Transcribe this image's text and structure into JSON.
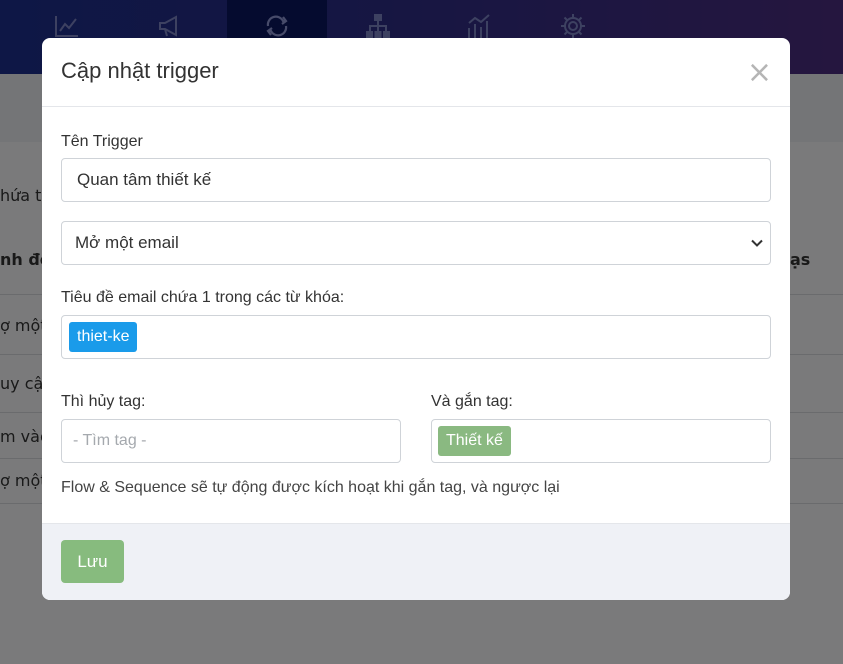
{
  "background": {
    "fragments": [
      "hứa t",
      "nh độ",
      "ợ một",
      "uy cập",
      "m vào",
      "ợ một",
      "ạs"
    ]
  },
  "nav": {
    "icons": [
      "chart-icon",
      "megaphone-icon",
      "repeat-icon",
      "sitemap-icon",
      "bar-chart-icon",
      "gear-icon"
    ]
  },
  "modal": {
    "title": "Cập nhật trigger",
    "close_label": "×",
    "name_label": "Tên Trigger",
    "name_value": "Quan tâm thiết kế",
    "event_select": {
      "selected": "Mở một email"
    },
    "keywords_label": "Tiêu đề email chứa 1 trong các từ khóa:",
    "keyword_tags": [
      "thiet-ke"
    ],
    "remove_tag_label": "Thì hủy tag:",
    "remove_tag_placeholder": "- Tìm tag -",
    "add_tag_label": "Và gắn tag:",
    "add_tags": [
      "Thiết kế"
    ],
    "hint": "Flow & Sequence sẽ tự động được kích hoạt khi gắn tag, và ngược lại",
    "save_label": "Lưu"
  },
  "colors": {
    "accent_blue": "#1a9bea",
    "tag_green": "#8ab981",
    "save_green": "#87bb7e"
  }
}
